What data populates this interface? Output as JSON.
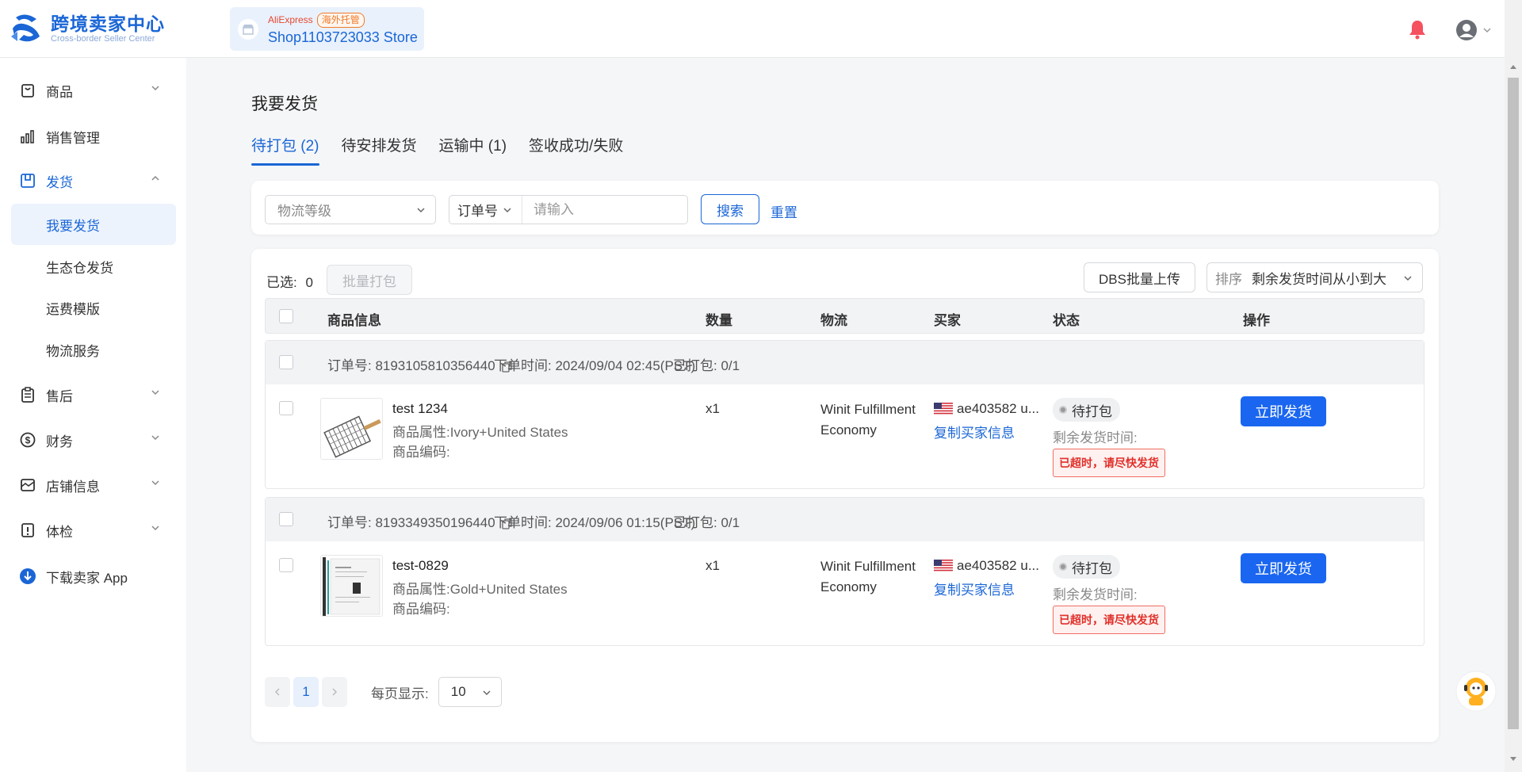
{
  "header": {
    "logo_title": "跨境卖家中心",
    "logo_subtitle": "Cross-border Seller Center",
    "store_platform": "AliExpress",
    "store_tag": "海外托管",
    "store_name": "Shop1103723033 Store"
  },
  "sidebar": {
    "items": [
      {
        "label": "商品"
      },
      {
        "label": "销售管理"
      },
      {
        "label": "发货"
      },
      {
        "label": "售后"
      },
      {
        "label": "财务"
      },
      {
        "label": "店铺信息"
      },
      {
        "label": "体检"
      },
      {
        "label": "下载卖家 App"
      }
    ],
    "sub_items": [
      {
        "label": "我要发货"
      },
      {
        "label": "生态仓发货"
      },
      {
        "label": "运费模版"
      },
      {
        "label": "物流服务"
      }
    ]
  },
  "main": {
    "page_title": "我要发货",
    "tabs": [
      {
        "label": "待打包 (2)"
      },
      {
        "label": "待安排发货"
      },
      {
        "label": "运输中 (1)"
      },
      {
        "label": "签收成功/失败"
      }
    ]
  },
  "filter": {
    "logistics_placeholder": "物流等级",
    "order_type": "订单号",
    "order_placeholder": "请输入",
    "search_label": "搜索",
    "reset_label": "重置"
  },
  "toolbar": {
    "selected_label": "已选:",
    "selected_count": "0",
    "batch_pack_label": "批量打包",
    "dbs_upload_label": "DBS批量上传",
    "sort_prefix": "排序",
    "sort_value": "剩余发货时间从小到大"
  },
  "table": {
    "columns": [
      "商品信息",
      "数量",
      "物流",
      "买家",
      "状态",
      "操作"
    ]
  },
  "orders": [
    {
      "order_no_label": "订单号: 8193105810356440",
      "order_time_label": "下单时间: 2024/09/04 02:45(PST)",
      "packed_label": "已打包: 0/1",
      "product_name": "test 1234",
      "product_attr": "商品属性:Ivory+United States",
      "product_code": "商品编码:",
      "quantity": "x1",
      "logistics_line1": "Winit Fulfillment",
      "logistics_line2": "Economy",
      "buyer": "ae403582 u...",
      "copy_buyer_label": "复制买家信息",
      "status": "待打包",
      "remain_label": "剩余发货时间:",
      "overdue_label": "已超时，请尽快发货",
      "ship_label": "立即发货"
    },
    {
      "order_no_label": "订单号: 8193349350196440",
      "order_time_label": "下单时间: 2024/09/06 01:15(PST)",
      "packed_label": "已打包: 0/1",
      "product_name": "test-0829",
      "product_attr": "商品属性:Gold+United States",
      "product_code": "商品编码:",
      "quantity": "x1",
      "logistics_line1": "Winit Fulfillment",
      "logistics_line2": "Economy",
      "buyer": "ae403582 u...",
      "copy_buyer_label": "复制买家信息",
      "status": "待打包",
      "remain_label": "剩余发货时间:",
      "overdue_label": "已超时，请尽快发货",
      "ship_label": "立即发货"
    }
  ],
  "pagination": {
    "current_page": "1",
    "per_page_label": "每页显示:",
    "per_page_value": "10"
  },
  "colors": {
    "primary": "#1a66d6",
    "ship_button": "#1a66f0",
    "overdue_text": "#e0302a",
    "notification": "#f5515f"
  }
}
